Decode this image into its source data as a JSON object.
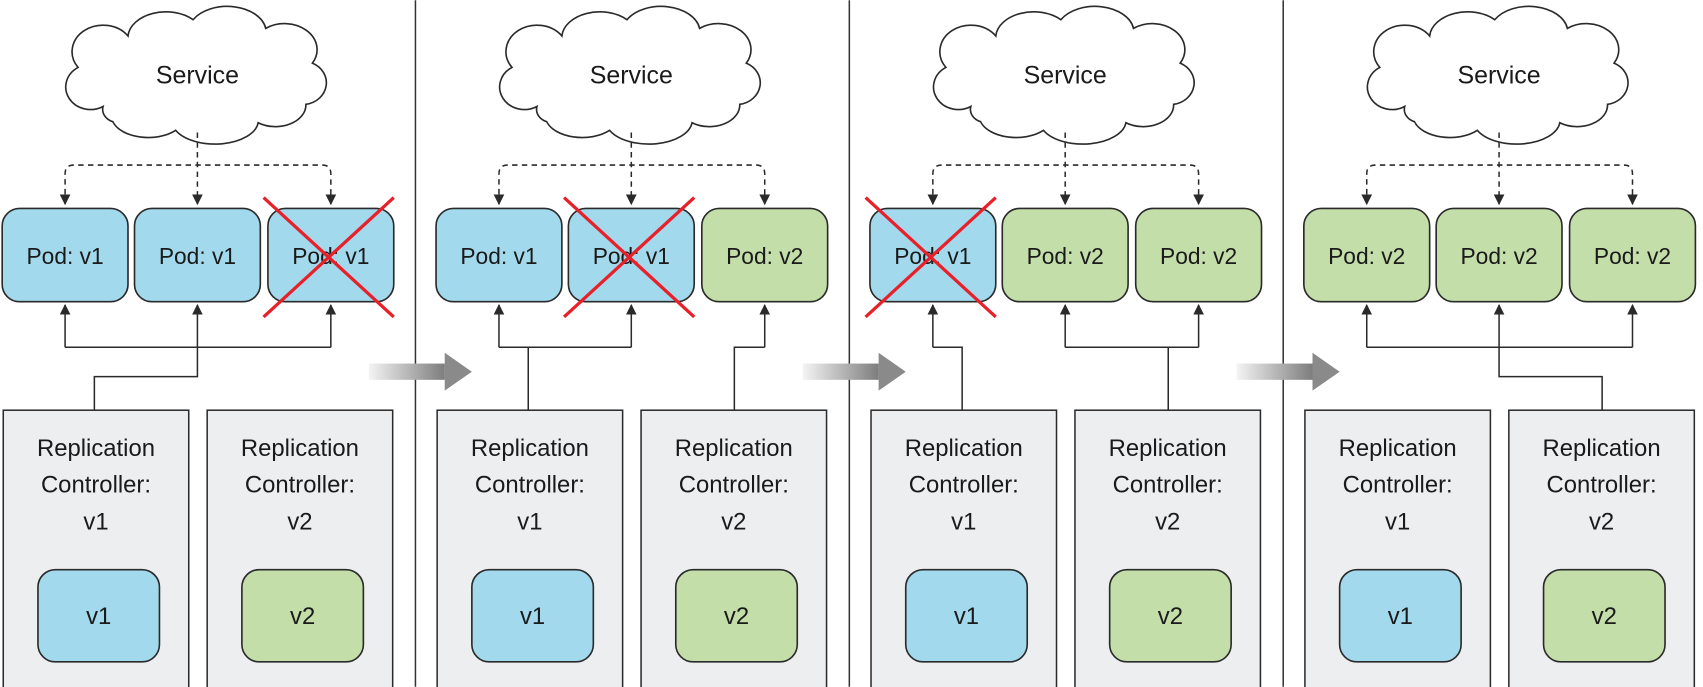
{
  "colors": {
    "v1": "#a3d9ec",
    "v2": "#c4deaa",
    "controller_bg": "#eceef0",
    "stroke": "#2a2a2a",
    "removed_cross": "#e8202a",
    "transition_arrow": "#8a8a8a"
  },
  "panels": [
    {
      "service": "Service",
      "pods": [
        {
          "label": "Pod: v1",
          "version": "v1",
          "removed": false
        },
        {
          "label": "Pod: v1",
          "version": "v1",
          "removed": false
        },
        {
          "label": "Pod: v1",
          "version": "v1",
          "removed": true
        }
      ],
      "controllers": [
        {
          "title": [
            "Replication",
            "Controller:",
            "v1"
          ],
          "template": "v1",
          "version": "v1",
          "manages": [
            0,
            1,
            2
          ]
        },
        {
          "title": [
            "Replication",
            "Controller:",
            "v2"
          ],
          "template": "v2",
          "version": "v2",
          "manages": []
        }
      ]
    },
    {
      "service": "Service",
      "pods": [
        {
          "label": "Pod: v1",
          "version": "v1",
          "removed": false
        },
        {
          "label": "Pod: v1",
          "version": "v1",
          "removed": true
        },
        {
          "label": "Pod: v2",
          "version": "v2",
          "removed": false
        }
      ],
      "controllers": [
        {
          "title": [
            "Replication",
            "Controller:",
            "v1"
          ],
          "template": "v1",
          "version": "v1",
          "manages": [
            0,
            1
          ]
        },
        {
          "title": [
            "Replication",
            "Controller:",
            "v2"
          ],
          "template": "v2",
          "version": "v2",
          "manages": [
            2
          ]
        }
      ]
    },
    {
      "service": "Service",
      "pods": [
        {
          "label": "Pod: v1",
          "version": "v1",
          "removed": true
        },
        {
          "label": "Pod: v2",
          "version": "v2",
          "removed": false
        },
        {
          "label": "Pod: v2",
          "version": "v2",
          "removed": false
        }
      ],
      "controllers": [
        {
          "title": [
            "Replication",
            "Controller:",
            "v1"
          ],
          "template": "v1",
          "version": "v1",
          "manages": [
            0
          ]
        },
        {
          "title": [
            "Replication",
            "Controller:",
            "v2"
          ],
          "template": "v2",
          "version": "v2",
          "manages": [
            1,
            2
          ]
        }
      ]
    },
    {
      "service": "Service",
      "pods": [
        {
          "label": "Pod: v2",
          "version": "v2",
          "removed": false
        },
        {
          "label": "Pod: v2",
          "version": "v2",
          "removed": false
        },
        {
          "label": "Pod: v2",
          "version": "v2",
          "removed": false
        }
      ],
      "controllers": [
        {
          "title": [
            "Replication",
            "Controller:",
            "v1"
          ],
          "template": "v1",
          "version": "v1",
          "manages": []
        },
        {
          "title": [
            "Replication",
            "Controller:",
            "v2"
          ],
          "template": "v2",
          "version": "v2",
          "manages": [
            0,
            1,
            2
          ]
        }
      ]
    }
  ]
}
